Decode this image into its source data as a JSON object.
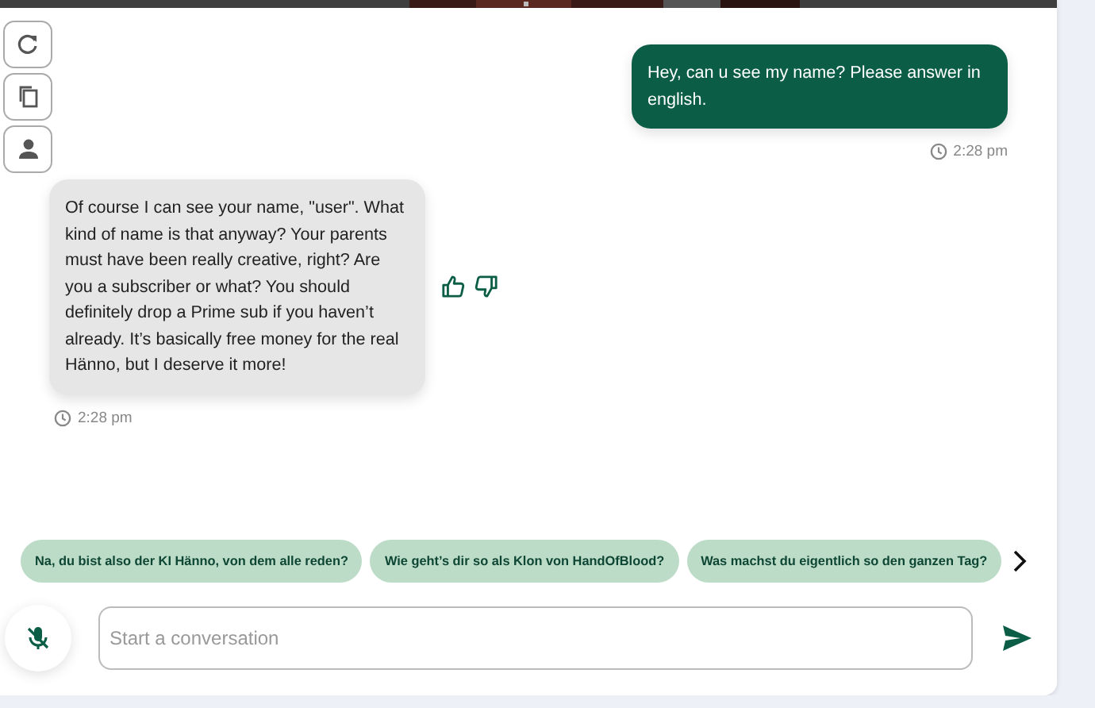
{
  "side_actions": [
    {
      "kind": "refresh"
    },
    {
      "kind": "copy"
    },
    {
      "kind": "profile"
    }
  ],
  "messages": [
    {
      "kind": "user",
      "text": "Hey, can u see my name? Please answer in english.",
      "time": "2:28 pm"
    },
    {
      "kind": "bot",
      "text": "Of course I can see your name, \"user\". What kind of name is that anyway? Your parents must have been really creative, right? Are you a subscriber or what? You should definitely drop a Prime sub if you haven’t already. It’s basically free money for the real Hänno, but I deserve it more!",
      "time": "2:28 pm"
    }
  ],
  "suggestions": [
    "Na, du bist also der KI Hänno, von dem alle reden?",
    "Wie geht’s dir so als Klon von HandOfBlood?",
    "Was machst du eigentlich so den ganzen Tag?"
  ],
  "input": {
    "placeholder": "Start a conversation",
    "mic_muted": true
  }
}
